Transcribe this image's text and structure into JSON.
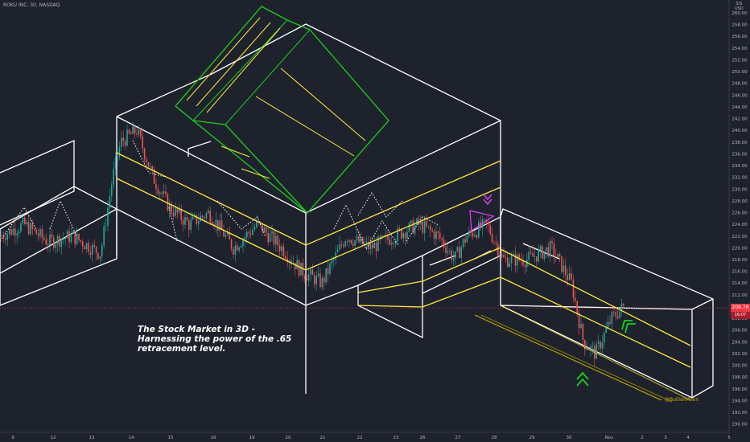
{
  "chart_data": {
    "type": "candlestick",
    "symbol_label": "ROKU INC, 30, NASDAQ",
    "currency_label": "USD",
    "currency_prefix": "5/S",
    "y_axis_ticks": [
      190,
      192,
      194,
      196,
      198,
      200,
      202,
      204,
      206,
      208,
      210,
      212,
      214,
      216,
      218,
      220,
      222,
      224,
      226,
      228,
      230,
      232,
      234,
      236,
      238,
      240,
      242,
      244,
      246,
      248,
      250,
      252,
      254,
      256,
      258,
      260
    ],
    "ylim": [
      189,
      261.5
    ],
    "x_axis_ticks": [
      "9",
      "12",
      "13",
      "14",
      "15",
      "16",
      "19",
      "20",
      "21",
      "22",
      "23",
      "26",
      "27",
      "28",
      "29",
      "30",
      "Nov",
      "2",
      "3",
      "4",
      "5"
    ],
    "last_price": "209.76",
    "countdown": "16:07",
    "annotation": "The Stock Market in 3D - Harnessing the power of the .65 retracement level.",
    "copyright": "@BullishMoon",
    "colors": {
      "background": "#1e222d",
      "up_candle": "#26a69a",
      "down_candle": "#ef5350",
      "boxes": "#ffffff",
      "channels": "#ffeb3b",
      "cube": "#19d219",
      "arrows_up": "#19d219",
      "arrows_down": "#e040fb",
      "price_line": "#f23645"
    },
    "close_path": [
      {
        "x": 0,
        "p": 222
      },
      {
        "x": 30,
        "p": 224
      },
      {
        "x": 60,
        "p": 221
      },
      {
        "x": 90,
        "p": 222
      },
      {
        "x": 125,
        "p": 219
      },
      {
        "x": 140,
        "p": 232
      },
      {
        "x": 150,
        "p": 238
      },
      {
        "x": 170,
        "p": 240
      },
      {
        "x": 190,
        "p": 232
      },
      {
        "x": 210,
        "p": 227
      },
      {
        "x": 235,
        "p": 224
      },
      {
        "x": 260,
        "p": 226
      },
      {
        "x": 290,
        "p": 220
      },
      {
        "x": 320,
        "p": 224
      },
      {
        "x": 350,
        "p": 220
      },
      {
        "x": 375,
        "p": 216
      },
      {
        "x": 400,
        "p": 214
      },
      {
        "x": 430,
        "p": 222
      },
      {
        "x": 460,
        "p": 220
      },
      {
        "x": 490,
        "p": 222
      },
      {
        "x": 520,
        "p": 224
      },
      {
        "x": 545,
        "p": 222
      },
      {
        "x": 565,
        "p": 218
      },
      {
        "x": 580,
        "p": 222
      },
      {
        "x": 605,
        "p": 224
      },
      {
        "x": 625,
        "p": 218
      },
      {
        "x": 655,
        "p": 218
      },
      {
        "x": 685,
        "p": 220
      },
      {
        "x": 710,
        "p": 214
      },
      {
        "x": 725,
        "p": 204
      },
      {
        "x": 740,
        "p": 202
      },
      {
        "x": 760,
        "p": 208
      },
      {
        "x": 775,
        "p": 210
      }
    ]
  }
}
